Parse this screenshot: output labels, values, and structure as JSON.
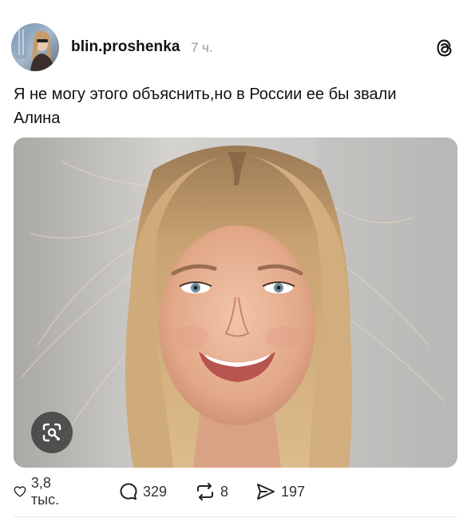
{
  "post": {
    "username": "blin.proshenka",
    "time": "7 ч.",
    "text": "Я не могу этого объяснить,но в России ее бы звали Алина"
  },
  "actions": {
    "likes": "3,8 тыс.",
    "comments": "329",
    "reposts": "8",
    "shares": "197"
  },
  "icons": {
    "header": "threads-logo-icon",
    "image": "visual-search-icon",
    "like": "heart-icon",
    "comment": "comment-bubble-icon",
    "repost": "repost-icon",
    "share": "send-icon"
  },
  "colors": {
    "text": "#111111",
    "muted": "#9a9a9a",
    "counts": "#333333",
    "background": "#ffffff"
  }
}
